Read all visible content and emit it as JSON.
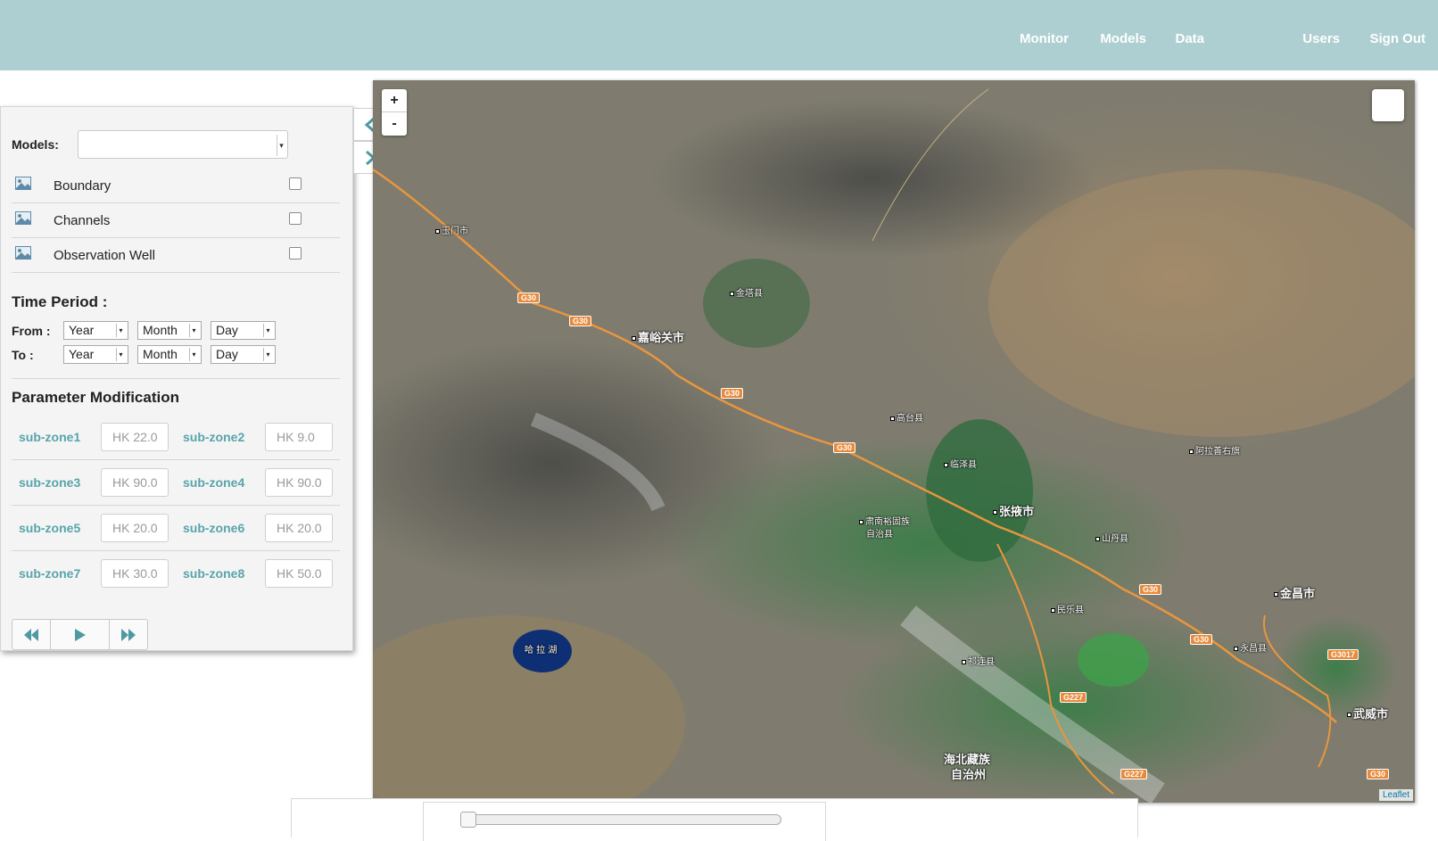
{
  "nav": {
    "monitor": "Monitor",
    "models": "Models",
    "data": "Data",
    "users": "Users",
    "sign_out": "Sign Out"
  },
  "panel": {
    "models_label": "Models:",
    "models_value": "",
    "layers": [
      {
        "name": "Boundary",
        "checked": false
      },
      {
        "name": "Channels",
        "checked": false
      },
      {
        "name": "Observation Well",
        "checked": false
      }
    ],
    "time_period_title": "Time Period :",
    "from_label": "From :",
    "to_label": "To :",
    "from": {
      "year": "Year",
      "month": "Month",
      "day": "Day"
    },
    "to": {
      "year": "Year",
      "month": "Month",
      "day": "Day"
    },
    "param_title": "Parameter Modification",
    "zones": [
      {
        "label": "sub-zone1",
        "placeholder": "HK 22.0"
      },
      {
        "label": "sub-zone2",
        "placeholder": "HK 9.0"
      },
      {
        "label": "sub-zone3",
        "placeholder": "HK 90.0"
      },
      {
        "label": "sub-zone4",
        "placeholder": "HK 90.0"
      },
      {
        "label": "sub-zone5",
        "placeholder": "HK 20.0"
      },
      {
        "label": "sub-zone6",
        "placeholder": "HK 20.0"
      },
      {
        "label": "sub-zone7",
        "placeholder": "HK 30.0"
      },
      {
        "label": "sub-zone8",
        "placeholder": "HK 50.0"
      }
    ]
  },
  "map": {
    "zoom_in": "+",
    "zoom_out": "-",
    "attribution": "Leaflet",
    "places": {
      "p1": "玉门市",
      "p2": "金塔县",
      "p3": "嘉峪关市",
      "p4": "高台县",
      "p5": "临泽县",
      "p6": "阿拉善右旗",
      "p7": "张掖市",
      "p8": "肃南裕固族",
      "p8b": "自治县",
      "p9": "山丹县",
      "p10": "金昌市",
      "p11": "民乐县",
      "p12": "永昌县",
      "p13": "祁连县",
      "p14": "武威市",
      "p15": "海北藏族",
      "p15b": "自治州",
      "lake": "哈 拉 湖"
    },
    "highways": {
      "g30": "G30",
      "g227": "G227",
      "g3017": "G3017"
    }
  },
  "colors": {
    "header": "#aecfd1",
    "accent": "#58a4aa"
  },
  "icons": {
    "collapse": "chevron-left-icon",
    "expand": "chevron-right-icon",
    "layer": "image-icon",
    "rewind": "rewind-icon",
    "play": "play-icon",
    "forward": "fast-forward-icon"
  }
}
